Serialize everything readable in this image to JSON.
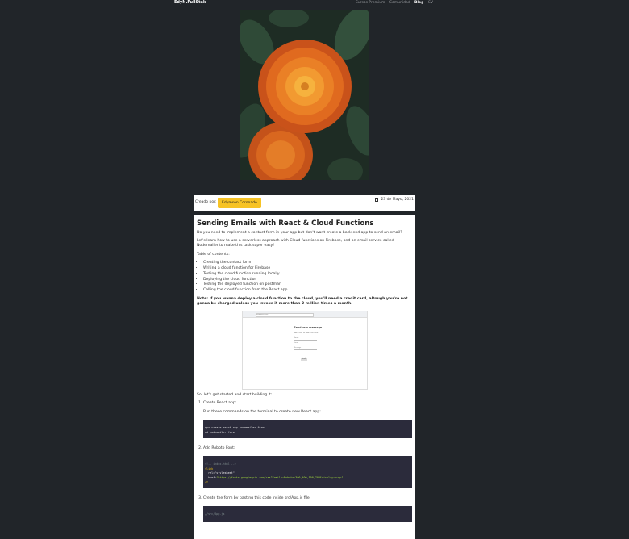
{
  "nav": {
    "brand": "EdyN.FullStak",
    "items": [
      "Cursos Premium",
      "Comunidad",
      "Blog",
      "CV"
    ],
    "active": "Blog"
  },
  "meta": {
    "created_label": "Creado por:",
    "author": "Edymson Coronado",
    "date": "23 de Mayo, 2021"
  },
  "article": {
    "title": "Sending Emails with React & Cloud Functions",
    "intro": "Do you need to implement a contact form in your app but don't want create a back-end app to send an email?",
    "intro2": "Let's learn how to use a serverless approach with Cloud functions on Firebase, and an email service called Nodemailer to make this task super easy!",
    "toc_label": "Table of contents:",
    "toc": [
      "Creating the contact form",
      "Writing a cloud function for Firebase",
      "Testing the cloud function running locally",
      "Deploying the cloud function",
      "Testing the deployed function on postman",
      "Calling the cloud function from the React app"
    ],
    "note": "Note: if you wanna deploy a cloud function to the cloud, you'll need a credit card, altough you're not gonna be charged unless you invoke it more than 2 million times a month.",
    "screenshot": {
      "url": "localhost:3000",
      "title": "Send us a message",
      "subtitle": "We'd love to hear from you",
      "fields": [
        "Name",
        "Email",
        "Message"
      ],
      "button": "Send"
    },
    "lets_start": "So, let's get started and start building it:",
    "steps": [
      {
        "label": "Create React app:",
        "desc": "Run these commands on the terminal to create new React app:"
      },
      {
        "label": "Add Roboto Font:"
      },
      {
        "label": "Create the form by pasting this code inside src/App.js file:"
      }
    ],
    "code1": [
      "npx create-react-app nodemailer-form",
      "cd nodemailer-form"
    ],
    "code2": {
      "comment": "<!-- index.html -->",
      "tag": "<link",
      "rel": "rel=\"stylesheet\"",
      "href_attr": "href=",
      "href_val": "\"https://fonts.googleapis.com/css?family=Roboto:300,400,500,700&display=swap\"",
      "close": "/>"
    },
    "code3": "//src/App.js"
  },
  "colors": {
    "background": "#212529",
    "badge": "#f7c325",
    "code_bg": "#2b2b3b"
  }
}
